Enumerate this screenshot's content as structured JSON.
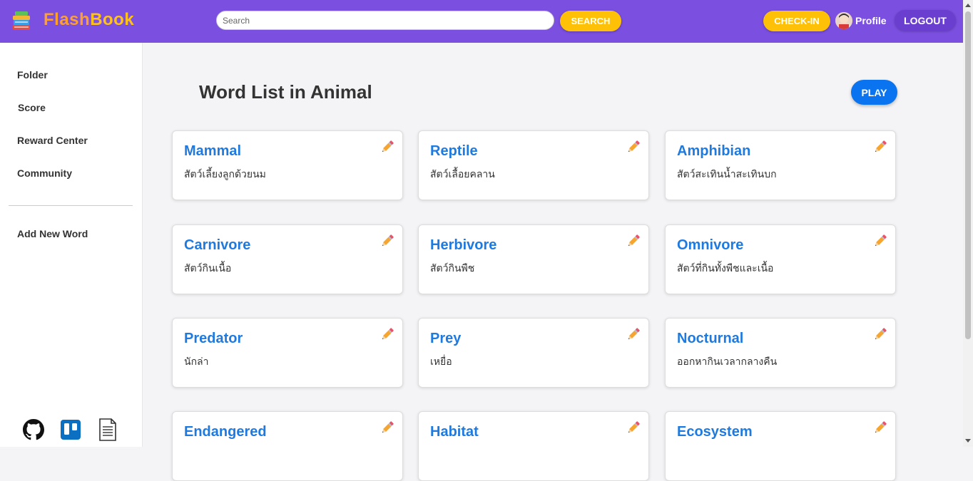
{
  "app": {
    "brand_part1": "Flash",
    "brand_part2": "Book",
    "brand_colors": [
      "#ff9f2e",
      "#ffc21a"
    ],
    "accent": "#7b4fe0"
  },
  "header": {
    "search_placeholder": "Search",
    "search_label": "SEARCH",
    "checkin_label": "CHECK-IN",
    "profile_label": "Profile",
    "logout_label": "LOGOUT"
  },
  "sidebar": {
    "items": [
      {
        "label": "Folder"
      },
      {
        "label": "Score"
      },
      {
        "label": "Reward Center"
      },
      {
        "label": "Community"
      }
    ],
    "add_word_label": "Add New Word",
    "footer_icons": [
      "github-icon",
      "trello-icon",
      "document-icon"
    ]
  },
  "main": {
    "title": "Word List in Animal",
    "play_label": "PLAY",
    "words": [
      {
        "word": "Mammal",
        "meaning": "สัตว์เลี้ยงลูกด้วยนม"
      },
      {
        "word": "Reptile",
        "meaning": "สัตว์เลื้อยคลาน"
      },
      {
        "word": "Amphibian",
        "meaning": "สัตว์สะเทินน้ำสะเทินบก"
      },
      {
        "word": "Carnivore",
        "meaning": "สัตว์กินเนื้อ"
      },
      {
        "word": "Herbivore",
        "meaning": "สัตว์กินพืช"
      },
      {
        "word": "Omnivore",
        "meaning": "สัตว์ที่กินทั้งพืชและเนื้อ"
      },
      {
        "word": "Predator",
        "meaning": "นักล่า"
      },
      {
        "word": "Prey",
        "meaning": "เหยื่อ"
      },
      {
        "word": "Nocturnal",
        "meaning": "ออกหากินเวลากลางคืน"
      },
      {
        "word": "Endangered",
        "meaning": ""
      },
      {
        "word": "Habitat",
        "meaning": ""
      },
      {
        "word": "Ecosystem",
        "meaning": ""
      }
    ]
  }
}
